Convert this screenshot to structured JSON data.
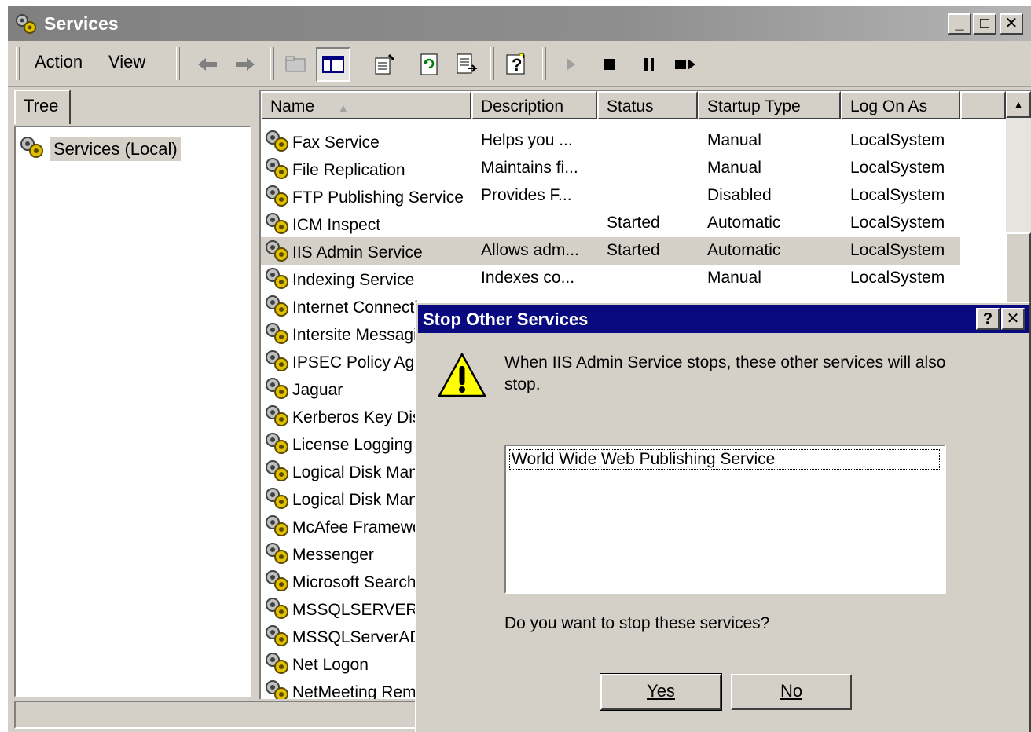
{
  "window": {
    "title": "Services"
  },
  "titlebar_buttons": {
    "minimize": "_",
    "maximize": "□",
    "close": "✕"
  },
  "menu": {
    "action": "Action",
    "view": "View"
  },
  "tree": {
    "tab": "Tree",
    "root": "Services (Local)"
  },
  "list": {
    "columns": [
      "Name",
      "Description",
      "Status",
      "Startup Type",
      "Log On As"
    ],
    "sort_indicator": "▲",
    "rows": [
      {
        "name": "Fax Service",
        "description": "Helps you ...",
        "status": "",
        "startup": "Manual",
        "logon": "LocalSystem"
      },
      {
        "name": "File Replication",
        "description": "Maintains fi...",
        "status": "",
        "startup": "Manual",
        "logon": "LocalSystem"
      },
      {
        "name": "FTP Publishing Service",
        "description": "Provides F...",
        "status": "",
        "startup": "Disabled",
        "logon": "LocalSystem"
      },
      {
        "name": "ICM Inspect",
        "description": "",
        "status": "Started",
        "startup": "Automatic",
        "logon": "LocalSystem"
      },
      {
        "name": "IIS Admin Service",
        "description": "Allows adm...",
        "status": "Started",
        "startup": "Automatic",
        "logon": "LocalSystem",
        "selected": true
      },
      {
        "name": "Indexing Service",
        "description": "Indexes co...",
        "status": "",
        "startup": "Manual",
        "logon": "LocalSystem"
      },
      {
        "name": "Internet Connection",
        "description": "",
        "status": "",
        "startup": "",
        "logon": ""
      },
      {
        "name": "Intersite Messaging",
        "description": "",
        "status": "",
        "startup": "",
        "logon": ""
      },
      {
        "name": "IPSEC Policy Agent",
        "description": "",
        "status": "",
        "startup": "",
        "logon": ""
      },
      {
        "name": "Jaguar",
        "description": "",
        "status": "",
        "startup": "",
        "logon": ""
      },
      {
        "name": "Kerberos Key Distribution",
        "description": "",
        "status": "",
        "startup": "",
        "logon": ""
      },
      {
        "name": "License Logging",
        "description": "",
        "status": "",
        "startup": "",
        "logon": ""
      },
      {
        "name": "Logical Disk Manager",
        "description": "",
        "status": "",
        "startup": "",
        "logon": ""
      },
      {
        "name": "Logical Disk Manager",
        "description": "",
        "status": "",
        "startup": "",
        "logon": ""
      },
      {
        "name": "McAfee Framework",
        "description": "",
        "status": "",
        "startup": "",
        "logon": ""
      },
      {
        "name": "Messenger",
        "description": "",
        "status": "",
        "startup": "",
        "logon": ""
      },
      {
        "name": "Microsoft Search",
        "description": "",
        "status": "",
        "startup": "",
        "logon": ""
      },
      {
        "name": "MSSQLSERVER",
        "description": "",
        "status": "",
        "startup": "",
        "logon": ""
      },
      {
        "name": "MSSQLServerADHelper",
        "description": "",
        "status": "",
        "startup": "",
        "logon": ""
      },
      {
        "name": "Net Logon",
        "description": "",
        "status": "",
        "startup": "",
        "logon": ""
      },
      {
        "name": "NetMeeting Remote Desktop",
        "description": "",
        "status": "",
        "startup": "",
        "logon": ""
      }
    ]
  },
  "dialog": {
    "title": "Stop Other Services",
    "help_button": "?",
    "close_button": "✕",
    "message": "When IIS Admin Service stops, these other services will also stop.",
    "dependent_services": [
      "World Wide Web Publishing Service"
    ],
    "question": "Do you want to stop these services?",
    "yes_label": "Yes",
    "no_label": "No"
  }
}
